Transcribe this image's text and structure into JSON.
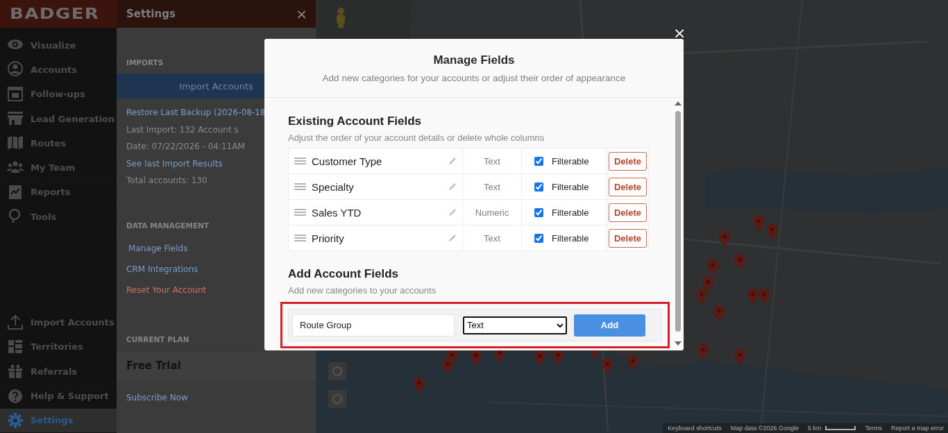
{
  "app": {
    "logo": "BADGER"
  },
  "nav": {
    "items": [
      {
        "label": "Visualize",
        "selected": false
      },
      {
        "label": "Accounts",
        "selected": false
      },
      {
        "label": "Follow-ups",
        "selected": false
      },
      {
        "label": "Lead Generation",
        "selected": false
      },
      {
        "label": "Routes",
        "selected": false
      },
      {
        "label": "My Team",
        "selected": false
      },
      {
        "label": "Reports",
        "selected": false
      },
      {
        "label": "Tools",
        "selected": false
      }
    ],
    "bottom_items": [
      {
        "label": "Import Accounts",
        "selected": false
      },
      {
        "label": "Territories",
        "selected": false
      },
      {
        "label": "Referrals",
        "selected": false
      },
      {
        "label": "Help & Support",
        "selected": false
      },
      {
        "label": "Settings",
        "selected": true
      }
    ]
  },
  "settings": {
    "title": "Settings",
    "close": "×",
    "imports": {
      "heading": "IMPORTS",
      "button": "Import Accounts",
      "lines": [
        {
          "text": "Restore Last Backup (2026-08-18",
          "kind": "link"
        },
        {
          "text": "Last Import: 132 Account s",
          "kind": "muted"
        },
        {
          "text": "Date: 07/22/2026 - 04:11AM",
          "kind": "muted"
        },
        {
          "text": "See last Import Results",
          "kind": "link"
        },
        {
          "text": "Total accounts: 130",
          "kind": "muted"
        }
      ]
    },
    "data_management": {
      "heading": "DATA MANAGEMENT",
      "links": [
        {
          "text": "Manage Fields",
          "kind": "link"
        },
        {
          "text": "CRM Integrations",
          "kind": "link"
        },
        {
          "text": "Reset Your Account",
          "kind": "danger"
        }
      ]
    },
    "current_plan": {
      "heading": "CURRENT PLAN",
      "plan": "Free Trial",
      "link": "Subscribe Now"
    }
  },
  "map": {
    "footer": [
      "Keyboard shortcuts",
      "Map data ©2026 Google",
      "5 km",
      "Terms",
      "Report a map error"
    ]
  },
  "modal": {
    "close": "×",
    "title": "Manage Fields",
    "subtitle": "Add new categories for your accounts or adjust their order of appearance",
    "existing": {
      "title": "Existing Account Fields",
      "subtitle": "Adjust the order of your account details or delete whole columns",
      "rows": [
        {
          "name": "Customer Type",
          "type": "Text",
          "filterable": true,
          "filter_label": "Filterable",
          "delete": "Delete"
        },
        {
          "name": "Specialty",
          "type": "Text",
          "filterable": true,
          "filter_label": "Filterable",
          "delete": "Delete"
        },
        {
          "name": "Sales YTD",
          "type": "Numeric",
          "filterable": true,
          "filter_label": "Filterable",
          "delete": "Delete"
        },
        {
          "name": "Priority",
          "type": "Text",
          "filterable": true,
          "filter_label": "Filterable",
          "delete": "Delete"
        }
      ]
    },
    "add": {
      "title": "Add Account Fields",
      "subtitle": "Add new categories to your accounts",
      "name_value": "Route Group",
      "type_value": "Text",
      "button": "Add"
    }
  }
}
